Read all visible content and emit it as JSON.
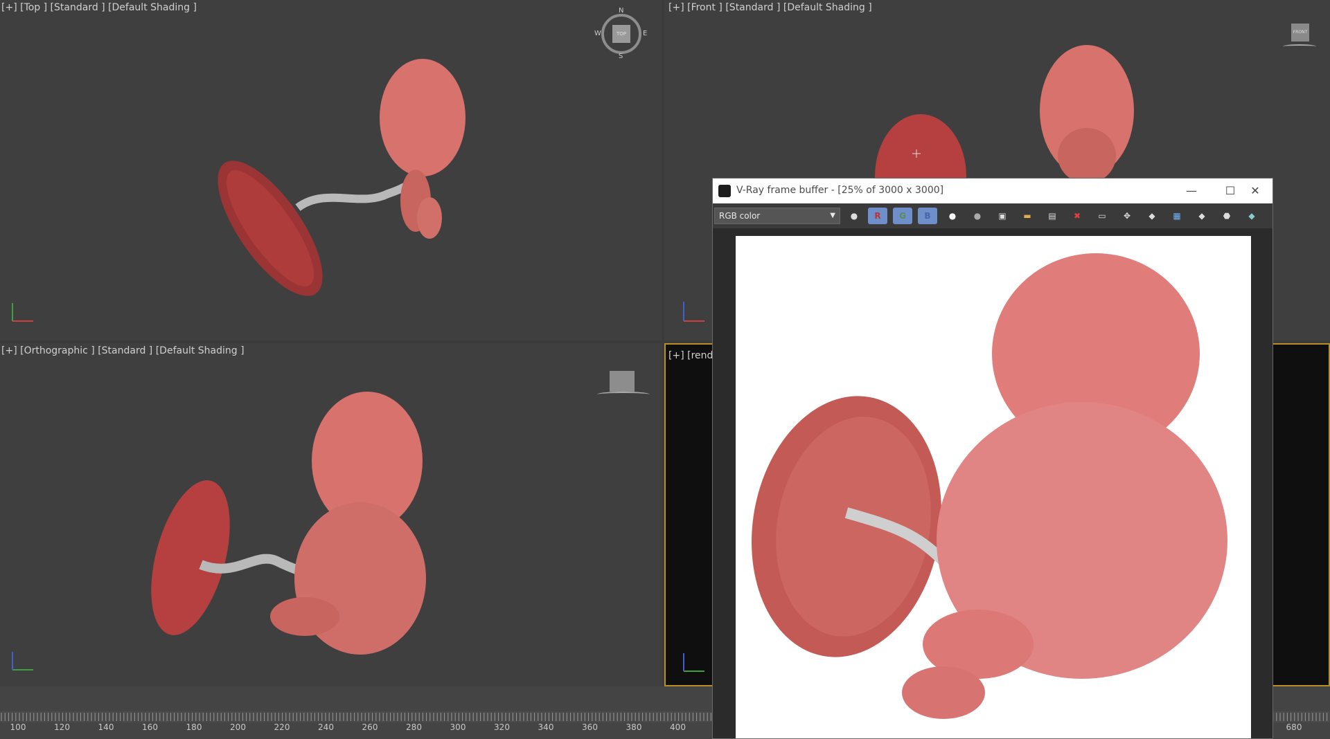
{
  "viewports": {
    "top": {
      "label": "[+] [Top ] [Standard ] [Default Shading ]"
    },
    "front": {
      "label": "[+] [Front ] [Standard ] [Default Shading ]"
    },
    "ortho": {
      "label": "[+] [Orthographic ] [Standard ] [Default Shading ]"
    },
    "render": {
      "label": "[+] [rende"
    }
  },
  "viewcube": {
    "top_label": "TOP",
    "front_label": "FRONT",
    "n": "N",
    "s": "S",
    "e": "E",
    "w": "W"
  },
  "axes": {
    "x": "x",
    "y": "y",
    "z": "z"
  },
  "timeline": {
    "ticks": [
      "100",
      "120",
      "140",
      "160",
      "180",
      "200",
      "220",
      "240",
      "260",
      "280",
      "300",
      "320",
      "340",
      "360",
      "380",
      "400"
    ],
    "end_tick": "680"
  },
  "vfb": {
    "title": "V-Ray frame buffer - [25% of 3000 x 3000]",
    "channel": "RGB color",
    "buttons": {
      "r": "R",
      "g": "G",
      "b": "B"
    },
    "window_controls": {
      "minimize": "—",
      "maximize": "☐",
      "close": "✕"
    }
  },
  "colors": {
    "viewport_bg": "#3f3f3f",
    "active_border": "#b98e22",
    "model_skin": "#d7726c",
    "placenta": "#b5403f",
    "cord": "#b9b9b9"
  }
}
